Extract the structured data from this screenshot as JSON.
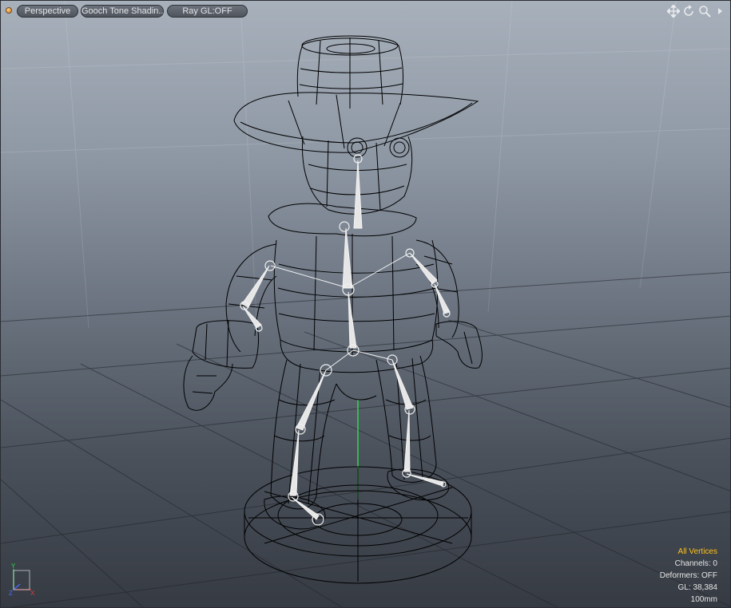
{
  "toolbar": {
    "view_label": "Perspective",
    "shading_label": "Gooch Tone Shadin...",
    "raygl_label": "Ray GL:OFF"
  },
  "nav_icons": [
    "move-view-icon",
    "rotate-view-icon",
    "zoom-view-icon",
    "viewport-menu-arrow-icon"
  ],
  "info": {
    "selection_mode": "All Vertices",
    "channels": "Channels: 0",
    "deformers": "Deformers: OFF",
    "gl": "GL: 38,384",
    "grid_size": "100mm"
  },
  "axis_labels": {
    "y": "Y",
    "x": "X",
    "z": "Z"
  },
  "colors": {
    "accent": "#ffc21a",
    "wireframe": "#000000",
    "bone": "#e6e6e6",
    "y_axis": "#2fd84a"
  }
}
